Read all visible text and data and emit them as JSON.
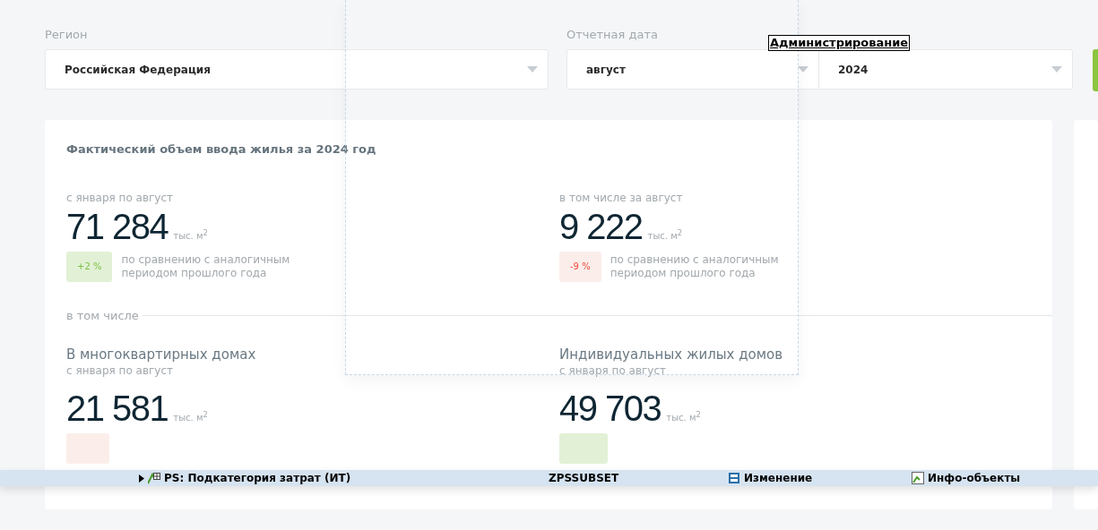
{
  "filters": {
    "region": {
      "label": "Регион",
      "value": "Российская Федерация"
    },
    "date": {
      "label": "Отчетная дата",
      "month": "август",
      "year": "2024"
    }
  },
  "card": {
    "title": "Фактический объем ввода жилья за 2024 год",
    "totals": [
      {
        "caption": "с января по август",
        "value": "71 284",
        "unit": "тыс. м$^{2}$",
        "change": "+2 %",
        "positive": true,
        "note": "по сравнению с аналогичным периодом прошлого года"
      },
      {
        "caption": "в том числе за август",
        "value": "9 222",
        "unit": "тыс. м$^{2}$",
        "change": "-9 %",
        "positive": false,
        "note": "по сравнению с аналогичным периодом прошлого года"
      }
    ],
    "section_label": "в том числе",
    "breakdown": [
      {
        "heading": "В многоквартирных домах",
        "caption": "с января по август",
        "value": "21 581",
        "unit": "тыс. м$^{2}$",
        "positive": false
      },
      {
        "heading": "Индивидуальных жилых домов",
        "caption": "с января по август",
        "value": "49 703",
        "unit": "тыс. м$^{2}$",
        "positive": true
      }
    ]
  },
  "tooltip": {
    "text": "Администрирование"
  },
  "overlay_row": {
    "cells": [
      "PS: Подкатегория затрат (ИТ)",
      "ZPSSUBSET",
      "Изменение",
      "Инфо-объекты"
    ]
  }
}
